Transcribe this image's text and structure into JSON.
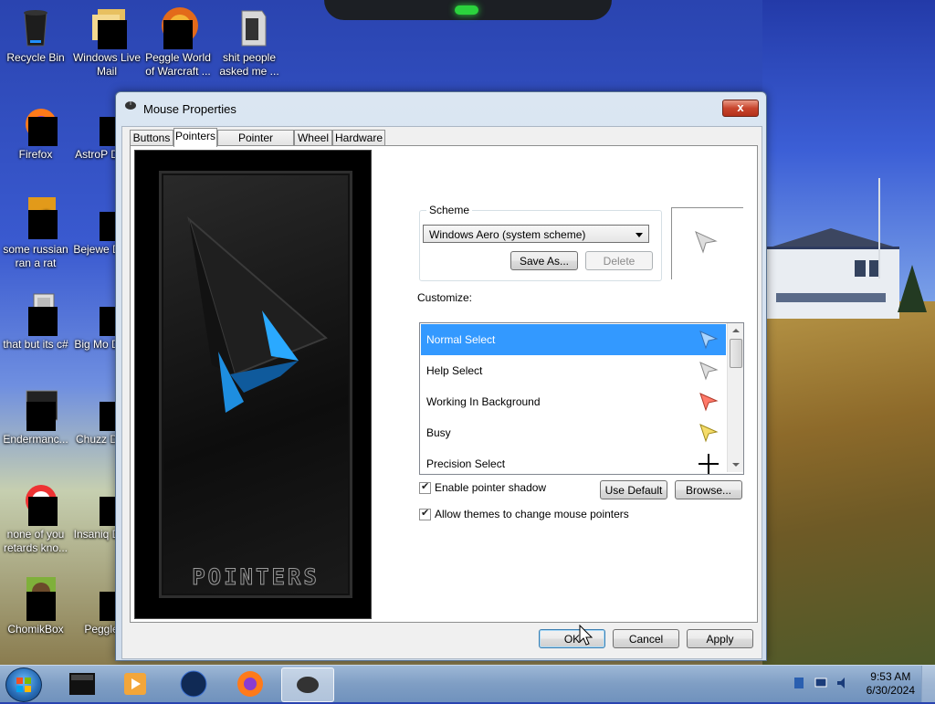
{
  "desktop": {
    "icons": [
      {
        "label": "Recycle Bin"
      },
      {
        "label": "Windows Live Mail"
      },
      {
        "label": "Peggle World of Warcraft ..."
      },
      {
        "label": "shit people asked me ..."
      },
      {
        "label": "Firefox"
      },
      {
        "label": "AstroP Delux"
      },
      {
        "label": "some russian ran a rat"
      },
      {
        "label": "Bejewe Delux"
      },
      {
        "label": "that but its c#"
      },
      {
        "label": "Big Mo Delux"
      },
      {
        "label": "Endermanc..."
      },
      {
        "label": "Chuzz Delux"
      },
      {
        "label": "none of you retards kno..."
      },
      {
        "label": "Insaniq Delux"
      },
      {
        "label": "ChomikBox"
      },
      {
        "label": "Peggle D"
      }
    ]
  },
  "window": {
    "title": "Mouse Properties",
    "close_label": "x",
    "tabs": [
      {
        "label": "Buttons"
      },
      {
        "label": "Pointers"
      },
      {
        "label": "Pointer Options"
      },
      {
        "label": "Wheel"
      },
      {
        "label": "Hardware"
      }
    ],
    "art_text": "POINTERS",
    "scheme": {
      "label": "Scheme",
      "selected": "Windows Aero (system scheme)",
      "save_as": "Save As...",
      "delete": "Delete"
    },
    "customize_label": "Customize:",
    "pointers": [
      {
        "label": "Normal Select",
        "icon": "arrow-cursor-icon"
      },
      {
        "label": "Help Select",
        "icon": "help-cursor-icon"
      },
      {
        "label": "Working In Background",
        "icon": "working-cursor-icon"
      },
      {
        "label": "Busy",
        "icon": "busy-cursor-icon"
      },
      {
        "label": "Precision Select",
        "icon": "crosshair-cursor-icon"
      }
    ],
    "enable_shadow": "Enable pointer shadow",
    "use_default": "Use Default",
    "browse": "Browse...",
    "allow_themes": "Allow themes to change mouse pointers",
    "ok": "OK",
    "cancel": "Cancel",
    "apply": "Apply"
  },
  "taskbar": {
    "time": "9:53 AM",
    "date": "6/30/2024"
  },
  "colors": {
    "selection": "#3399ff",
    "close_button": "#c8452d"
  }
}
